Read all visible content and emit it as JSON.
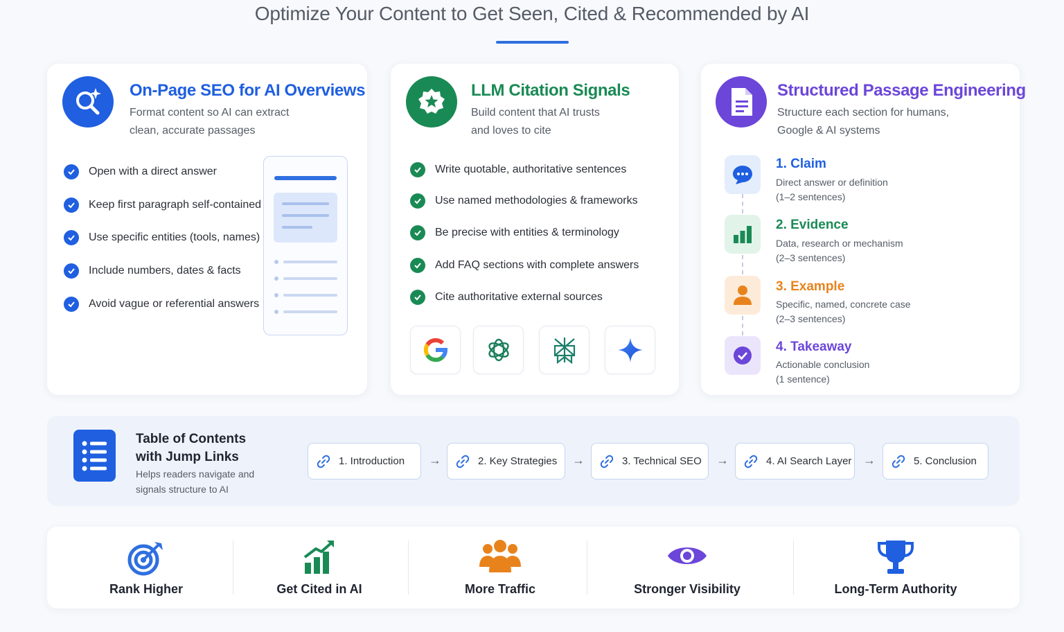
{
  "page": {
    "title": "Optimize Your Content to Get Seen, Cited & Recommended by AI"
  },
  "colors": {
    "blue": "#1f5fe0",
    "green": "#1a8a55",
    "purple": "#6c46d9",
    "orange": "#e8831c"
  },
  "card1": {
    "icon": "search-sparkle-icon",
    "title": "On-Page SEO for AI Overviews",
    "subtitle_line1": "Format content so AI can extract",
    "subtitle_line2": "clean, accurate passages",
    "items": [
      "Open with a direct answer",
      "Keep first paragraph self-contained",
      "Use specific entities (tools, names)",
      "Include numbers, dates & facts",
      "Avoid vague or referential answers"
    ]
  },
  "card2": {
    "icon": "star-badge-icon",
    "title": "LLM Citation Signals",
    "subtitle_line1": "Build content that AI trusts",
    "subtitle_line2": "and loves to cite",
    "items": [
      "Write quotable, authoritative sentences",
      "Use named methodologies & frameworks",
      "Be precise with entities & terminology",
      "Add FAQ sections with complete answers",
      "Cite authoritative external sources"
    ],
    "logos": [
      "google-logo-icon",
      "chatgpt-logo-icon",
      "perplexity-logo-icon",
      "gemini-logo-icon"
    ]
  },
  "card3": {
    "icon": "document-icon",
    "title": "Structured Passage Engineering",
    "subtitle_line1": "Structure each section for humans,",
    "subtitle_line2": "Google & AI systems",
    "steps": [
      {
        "title": "1. Claim",
        "desc1": "Direct answer or definition",
        "desc2": "(1–2 sentences)",
        "icon": "chat-bubble-icon"
      },
      {
        "title": "2. Evidence",
        "desc1": "Data, research or mechanism",
        "desc2": "(2–3 sentences)",
        "icon": "bar-chart-icon"
      },
      {
        "title": "3. Example",
        "desc1": "Specific, named, concrete case",
        "desc2": "(2–3 sentences)",
        "icon": "person-icon"
      },
      {
        "title": "4. Takeaway",
        "desc1": "Actionable conclusion",
        "desc2": "(1 sentence)",
        "icon": "check-circle-icon"
      }
    ]
  },
  "toc": {
    "icon": "list-icon",
    "title_line1": "Table of Contents",
    "title_line2": "with Jump Links",
    "desc_line1": "Helps readers navigate and",
    "desc_line2": "signals structure to AI",
    "links": [
      "1. Introduction",
      "2. Key Strategies",
      "3. Technical SEO",
      "4. AI Search Layer",
      "5. Conclusion"
    ],
    "arrow": "→"
  },
  "benefits": [
    {
      "label": "Rank Higher",
      "icon": "target-icon"
    },
    {
      "label": "Get Cited in AI",
      "icon": "growth-chart-icon"
    },
    {
      "label": "More Traffic",
      "icon": "people-icon"
    },
    {
      "label": "Stronger Visibility",
      "icon": "eye-icon"
    },
    {
      "label": "Long-Term Authority",
      "icon": "trophy-icon"
    }
  ]
}
